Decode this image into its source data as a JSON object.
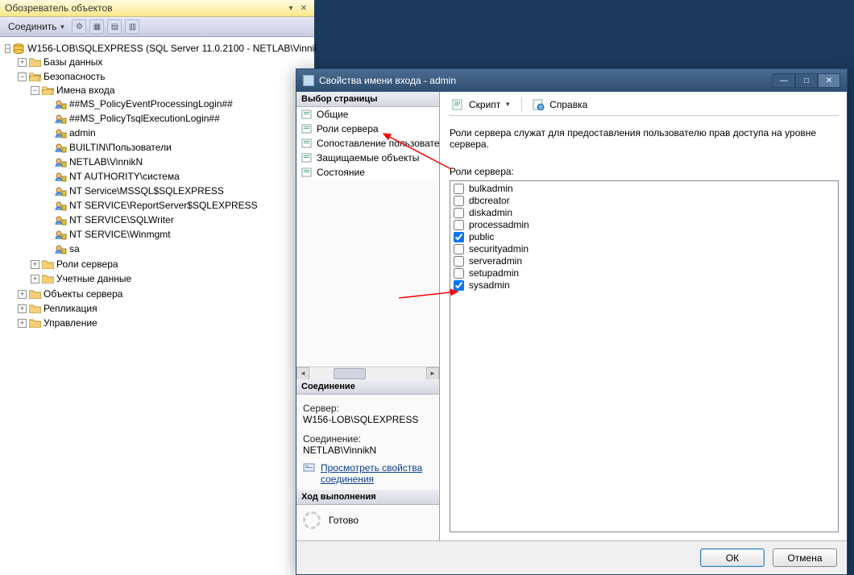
{
  "obj_explorer": {
    "title": "Обозреватель объектов",
    "connect_btn": "Соединить",
    "root": "W156-LOB\\SQLEXPRESS (SQL Server 11.0.2100 - NETLAB\\Vinnil",
    "folders": {
      "databases": "Базы данных",
      "security": "Безопасность",
      "logins": "Имена входа",
      "server_roles": "Роли сервера",
      "credentials": "Учетные данные",
      "server_objects": "Объекты сервера",
      "replication": "Репликация",
      "management": "Управление"
    },
    "logins": [
      "##MS_PolicyEventProcessingLogin##",
      "##MS_PolicyTsqlExecutionLogin##",
      "admin",
      "BUILTIN\\Пользователи",
      "NETLAB\\VinnikN",
      "NT AUTHORITY\\система",
      "NT Service\\MSSQL$SQLEXPRESS",
      "NT SERVICE\\ReportServer$SQLEXPRESS",
      "NT SERVICE\\SQLWriter",
      "NT SERVICE\\Winmgmt",
      "sa"
    ]
  },
  "dialog": {
    "title": "Свойства имени входа - admin",
    "page_select_header": "Выбор страницы",
    "pages": [
      "Общие",
      "Роли сервера",
      "Сопоставление пользователе",
      "Защищаемые объекты",
      "Состояние"
    ],
    "connection_header": "Соединение",
    "server_label": "Сервер:",
    "server_value": "W156-LOB\\SQLEXPRESS",
    "conn_label": "Соединение:",
    "conn_value": "NETLAB\\VinnikN",
    "view_conn_link": "Просмотреть свойства соединения",
    "progress_header": "Ход выполнения",
    "progress_value": "Готово",
    "toolbar": {
      "script": "Скрипт",
      "help": "Справка"
    },
    "description": "Роли сервера служат для предоставления пользователю прав доступа на уровне сервера.",
    "roles_label": "Роли сервера:",
    "roles": [
      {
        "name": "bulkadmin",
        "checked": false
      },
      {
        "name": "dbcreator",
        "checked": false
      },
      {
        "name": "diskadmin",
        "checked": false
      },
      {
        "name": "processadmin",
        "checked": false
      },
      {
        "name": "public",
        "checked": true
      },
      {
        "name": "securityadmin",
        "checked": false
      },
      {
        "name": "serveradmin",
        "checked": false
      },
      {
        "name": "setupadmin",
        "checked": false
      },
      {
        "name": "sysadmin",
        "checked": true
      }
    ],
    "ok": "ОК",
    "cancel": "Отмена"
  }
}
